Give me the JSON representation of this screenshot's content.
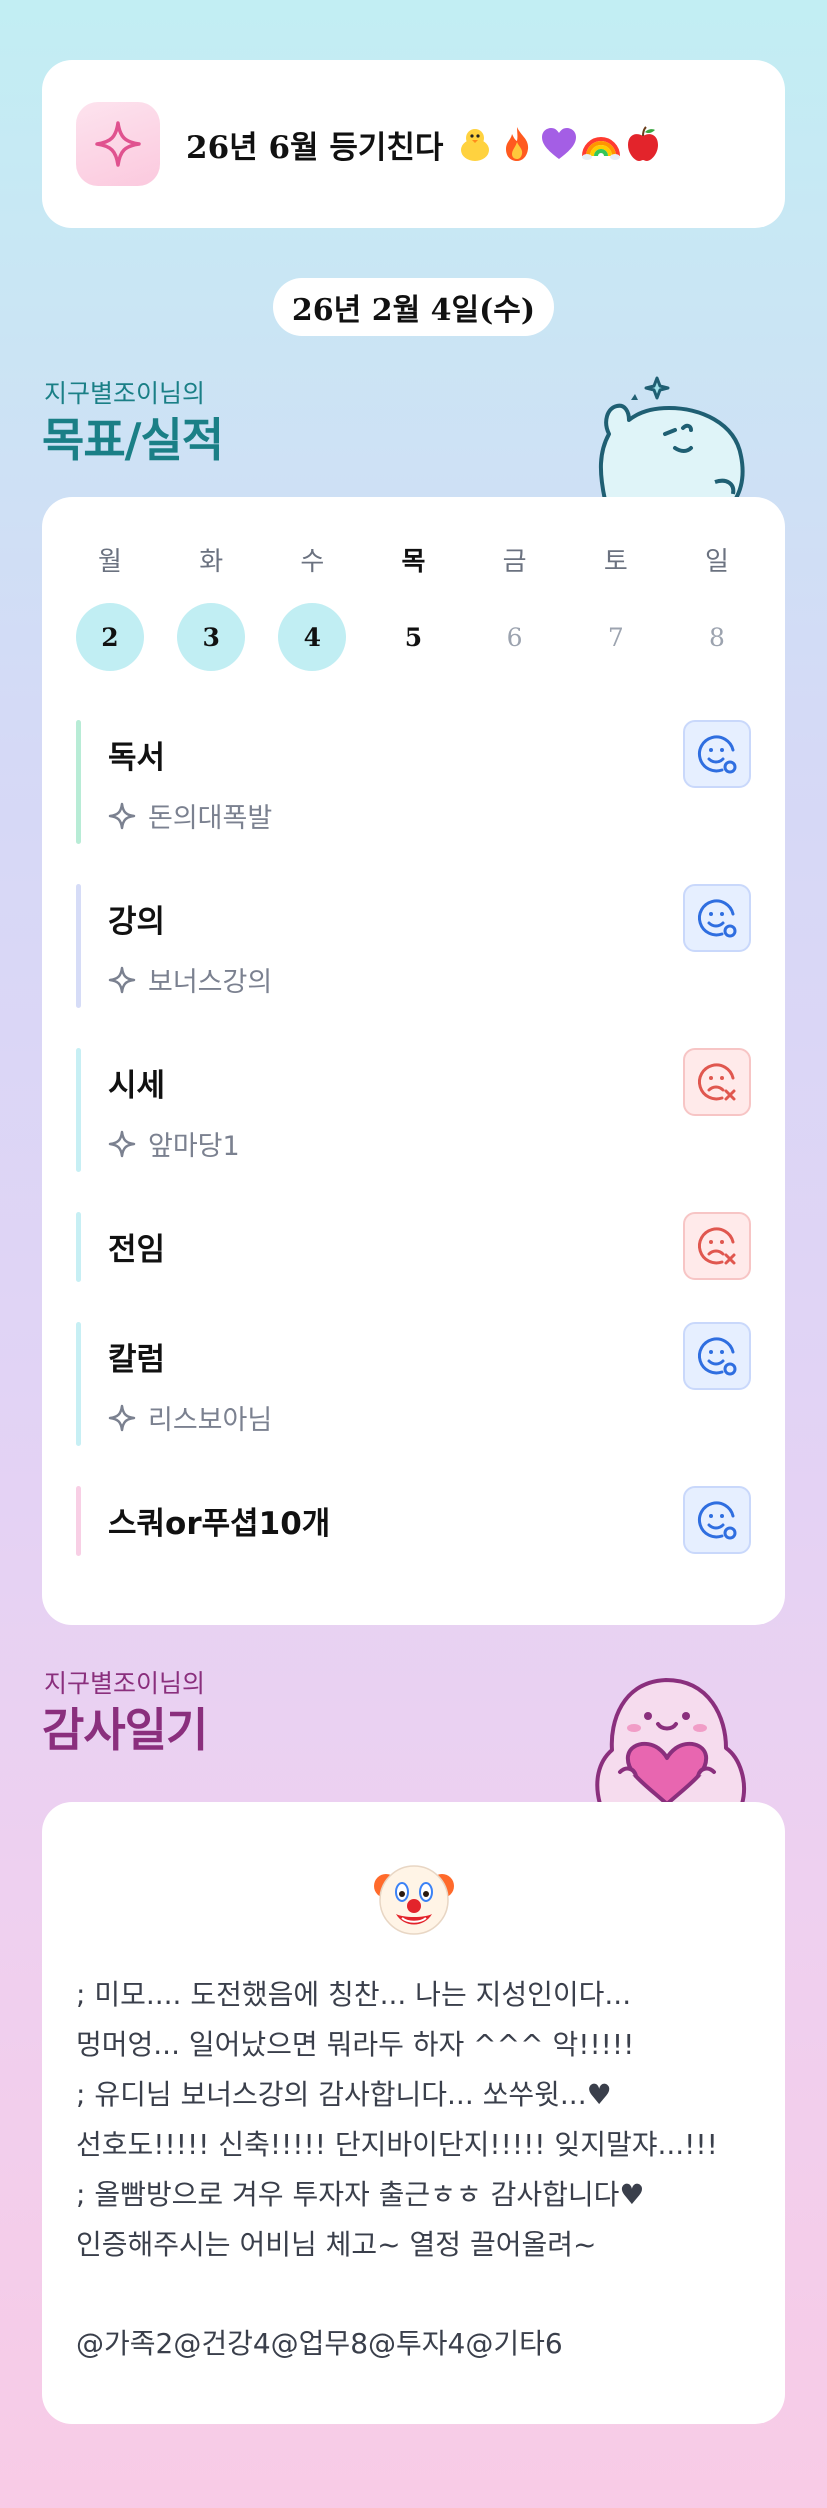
{
  "banner": {
    "icon": "sparkle-icon",
    "title": "26년 6월 등기친다",
    "emojis": [
      "chick-icon",
      "fire-icon",
      "purple-heart-icon",
      "rainbow-icon",
      "apple-icon"
    ]
  },
  "date_label": "26년 2월 4일(수)",
  "goals_section": {
    "subtitle": "지구별조이님의",
    "title": "목표/실적",
    "weekdays": [
      "월",
      "화",
      "수",
      "목",
      "금",
      "토",
      "일"
    ],
    "days": [
      {
        "num": "2",
        "state": "done"
      },
      {
        "num": "3",
        "state": "done"
      },
      {
        "num": "4",
        "state": "done"
      },
      {
        "num": "5",
        "state": "today"
      },
      {
        "num": "6",
        "state": "future"
      },
      {
        "num": "7",
        "state": "future"
      },
      {
        "num": "8",
        "state": "future"
      }
    ],
    "today_weekday_index": 3,
    "goals": [
      {
        "name": "독서",
        "sub": "돈의대폭발",
        "status": "success",
        "bar_color": "#b8ecd6"
      },
      {
        "name": "강의",
        "sub": "보너스강의",
        "status": "success",
        "bar_color": "#d6dcf7"
      },
      {
        "name": "시세",
        "sub": "앞마당1",
        "status": "fail",
        "bar_color": "#c7eff4"
      },
      {
        "name": "전임",
        "sub": "",
        "status": "fail",
        "bar_color": "#c7eff4"
      },
      {
        "name": "칼럼",
        "sub": "리스보아님",
        "status": "success",
        "bar_color": "#c7eff4"
      },
      {
        "name": "스쿼or푸셥10개",
        "sub": "",
        "status": "success",
        "bar_color": "#f8cfe5"
      }
    ]
  },
  "diary_section": {
    "subtitle": "지구별조이님의",
    "title": "감사일기",
    "mood_icon": "clown-face-icon",
    "lines": [
      "; 미모.... 도전했음에 칭찬... 나는 지성인이다...",
      "멍머엉... 일어났으면 뭐라두 하자 ^^^ 악!!!!!",
      "; 유디님 보너스강의 감사합니다... 쏘쑤윗...♥",
      "선호도!!!!! 신축!!!!! 단지바이단지!!!!! 잊지말쟈...!!!",
      "; 올빰방으로 겨우 투자자 출근ㅎㅎ 감사합니다♥",
      "인증해주시는 어비님 체고~ 열정 끌어올려~"
    ],
    "tags": "@가족2@건강4@업무8@투자4@기타6"
  },
  "colors": {
    "goals_title": "#1a7f86",
    "diary_title": "#8a2f7d",
    "success_icon": "#2f6ee0",
    "fail_icon": "#e0574f"
  }
}
